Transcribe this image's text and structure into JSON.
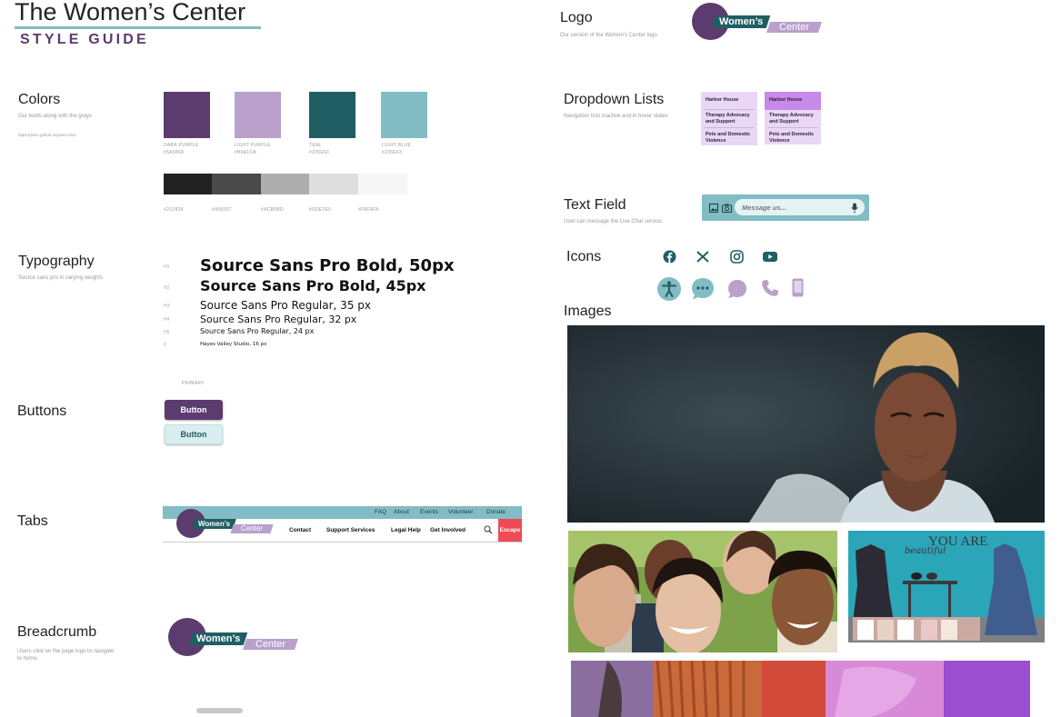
{
  "header": {
    "title": "The Women’s Center",
    "subtitle": "STYLE GUIDE"
  },
  "colors_section": {
    "title": "Colors",
    "desc": "Our bolds along with the grays",
    "link": "https://psss.github.io/pixel-color/",
    "swatches": [
      {
        "name": "DARK PURPLE",
        "hex": "#5C3B6E",
        "code": "#5A3868"
      },
      {
        "name": "LIGHT PURPLE",
        "hex": "#B9A1CB",
        "code": "#B9A1CA"
      },
      {
        "name": "TEAL",
        "hex": "#1F5E63",
        "code": "#235E63"
      },
      {
        "name": "LIGHT BLUE",
        "hex": "#82BCC4",
        "code": "#235E63"
      }
    ],
    "grays": [
      {
        "hex": "#222222",
        "code": "#212429"
      },
      {
        "hex": "#4A4A4A",
        "code": "#495057"
      },
      {
        "hex": "#ADADAD",
        "code": "#ACB5BD"
      },
      {
        "hex": "#DEDEDE",
        "code": "#DDE2E5"
      },
      {
        "hex": "#F6F6F6",
        "code": "#F8F9FA"
      }
    ]
  },
  "typography_section": {
    "title": "Typography",
    "desc": "Source sans pro in varying weights",
    "rows": [
      {
        "tag": "H1",
        "text": "Source Sans Pro Bold, 50px"
      },
      {
        "tag": "H2",
        "text": "Source Sans Pro Bold, 45px"
      },
      {
        "tag": "H3",
        "text": "Source Sans Pro Regular, 35 px"
      },
      {
        "tag": "H4",
        "text": "Source Sans Pro Regular, 32 px"
      },
      {
        "tag": "H5",
        "text": "Source Sans Pro Regular, 24 px"
      },
      {
        "tag": "P",
        "text": "Hayes Valley Studio, 16 px"
      }
    ]
  },
  "buttons_section": {
    "title": "Buttons",
    "primary_label": "PRIMARY",
    "primary_button": "Button",
    "secondary_button": "Button"
  },
  "tabs_section": {
    "title": "Tabs",
    "top_links": [
      "FAQ",
      "About",
      "Events",
      "Volunteer",
      "Donate"
    ],
    "main_links": [
      "Contact",
      "Support Services",
      "Legal Help",
      "Get Involved"
    ],
    "escape": "Escape"
  },
  "breadcrumb_section": {
    "title": "Breadcrumb",
    "desc": "Users click on the page logo to navigate to home."
  },
  "logo_section": {
    "title": "Logo",
    "desc": "Our version of the Women’s Center logo"
  },
  "logo_text": {
    "women": "Women’s",
    "center": "Center"
  },
  "dropdown_section": {
    "title": "Dropdown Lists",
    "desc": "Navigation lists inactive and in hover states",
    "items": [
      "Harbor House",
      "Therapy Advocacy and Support",
      "Pets and Domestic Violence"
    ]
  },
  "textfield_section": {
    "title": "Text Field",
    "desc": "User can message the Live Chat service.",
    "placeholder": "Message us..."
  },
  "icons_section": {
    "title": "Icons",
    "social": [
      "facebook-icon",
      "x-icon",
      "instagram-icon",
      "youtube-icon"
    ],
    "ui": [
      "accessibility-icon",
      "chat-more-icon",
      "chat-bubble-icon",
      "phone-icon",
      "mobile-icon"
    ]
  },
  "images_section": {
    "title": "Images",
    "wall_text_1": "YOU ARE",
    "wall_text_2": "beautiful"
  },
  "brand_colors": {
    "dark_purple": "#5C3B6E",
    "light_purple": "#B9A1CB",
    "teal": "#1F5E63",
    "light_blue": "#82BCC4",
    "escape_red": "#EF4A55",
    "dropdown_bg": "#EAD7F7",
    "dropdown_hover": "#C88AE8"
  }
}
